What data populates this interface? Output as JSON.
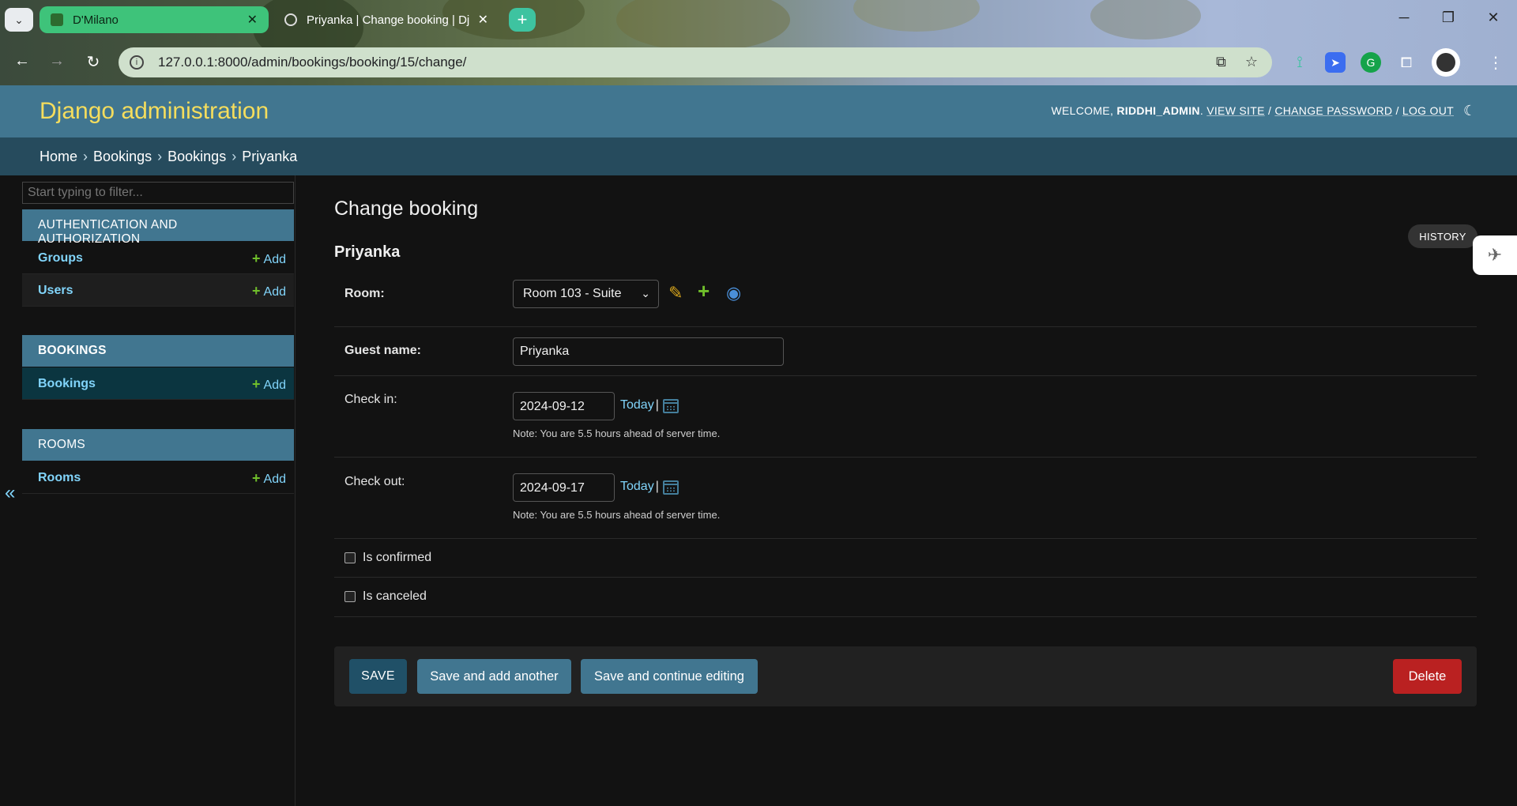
{
  "browser": {
    "tabs": [
      {
        "title": "D'Milano",
        "active": true
      },
      {
        "title": "Priyanka | Change booking | Dj",
        "active": false
      }
    ],
    "url": {
      "host": "127.0.0.1",
      "rest": ":8000/admin/bookings/booking/15/change/"
    }
  },
  "header": {
    "site_name": "Django administration",
    "welcome": "WELCOME,",
    "username": "RIDDHI_ADMIN",
    "view_site": "VIEW SITE",
    "change_password": "CHANGE PASSWORD",
    "log_out": "LOG OUT",
    "sep": "/"
  },
  "breadcrumbs": [
    "Home",
    "Bookings",
    "Bookings",
    "Priyanka"
  ],
  "sidebar": {
    "filter_placeholder": "Start typing to filter...",
    "modules": [
      {
        "caption": "AUTHENTICATION AND AUTHORIZATION",
        "rows": [
          {
            "name": "Groups",
            "add": "Add"
          },
          {
            "name": "Users",
            "add": "Add"
          }
        ]
      },
      {
        "caption": "BOOKINGS",
        "rows": [
          {
            "name": "Bookings",
            "add": "Add"
          }
        ]
      },
      {
        "caption": "ROOMS",
        "rows": [
          {
            "name": "Rooms",
            "add": "Add"
          }
        ]
      }
    ],
    "toggle": "«"
  },
  "content": {
    "title": "Change booking",
    "object": "Priyanka",
    "history": "HISTORY",
    "fields": {
      "room": {
        "label": "Room:",
        "value": "Room 103 - Suite"
      },
      "guest_name": {
        "label": "Guest name:",
        "value": "Priyanka"
      },
      "check_in": {
        "label": "Check in:",
        "value": "2024-09-12",
        "today": "Today",
        "note": "Note: You are 5.5 hours ahead of server time."
      },
      "check_out": {
        "label": "Check out:",
        "value": "2024-09-17",
        "today": "Today",
        "note": "Note: You are 5.5 hours ahead of server time."
      },
      "is_confirmed": {
        "label": "Is confirmed",
        "checked": false
      },
      "is_canceled": {
        "label": "Is canceled",
        "checked": false
      }
    },
    "buttons": {
      "save": "SAVE",
      "save_add_another": "Save and add another",
      "save_continue": "Save and continue editing",
      "delete": "Delete"
    }
  },
  "colors": {
    "header": "#417690",
    "breadcrumbs": "#264b5d",
    "site_name": "#f5dd5d",
    "link": "#81d4fa",
    "delete": "#ba2121"
  }
}
